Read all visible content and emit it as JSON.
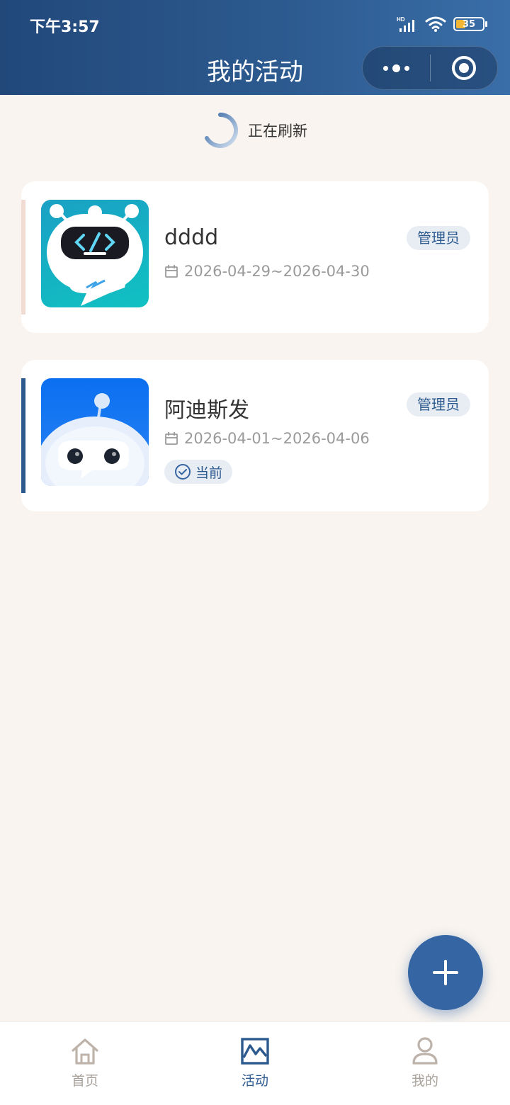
{
  "status_bar": {
    "time": "下午3:57",
    "network_label": "HD",
    "battery_level": "35",
    "battery_fraction": 0.35
  },
  "nav": {
    "title": "我的活动"
  },
  "refresh": {
    "label": "正在刷新"
  },
  "activities": [
    {
      "title": "dddd",
      "role": "管理员",
      "date_range": "2026-04-29~2026-04-30",
      "current_label": ""
    },
    {
      "title": "阿迪斯发",
      "role": "管理员",
      "date_range": "2026-04-01~2026-04-06",
      "current_label": "当前"
    }
  ],
  "fab": {
    "label": "+"
  },
  "tabbar": {
    "items": [
      {
        "label": "首页",
        "icon": "home-icon",
        "active": false
      },
      {
        "label": "活动",
        "icon": "activity-chart-icon",
        "active": true
      },
      {
        "label": "我的",
        "icon": "user-icon",
        "active": false
      }
    ]
  },
  "colors": {
    "brand": "#2c5a8f",
    "page_bg": "#f9f4ef",
    "accent_inactive": "#f0dcd3",
    "tab_inactive": "#a8a19a"
  }
}
